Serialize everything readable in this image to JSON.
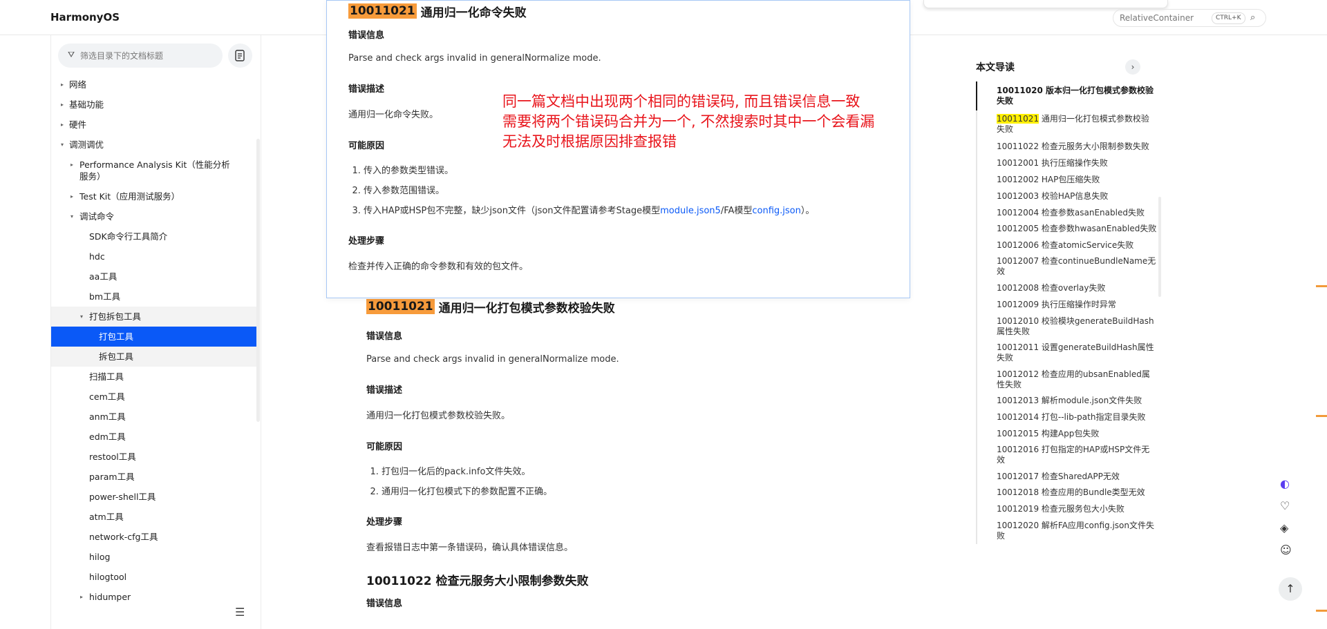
{
  "header": {
    "brand": "HarmonyOS",
    "search_text": "RelativeContainer",
    "search_shortcut": "CTRL+K"
  },
  "sidebar": {
    "filter_placeholder": "筛选目录下的文档标题",
    "items": [
      {
        "label": "网络",
        "arrow": "▸",
        "level": 0
      },
      {
        "label": "基础功能",
        "arrow": "▸",
        "level": 0
      },
      {
        "label": "硬件",
        "arrow": "▸",
        "level": 0
      },
      {
        "label": "调测调优",
        "arrow": "▾",
        "level": 0
      },
      {
        "label": "Performance Analysis Kit（性能分析服务）",
        "arrow": "▸",
        "level": 1
      },
      {
        "label": "Test Kit（应用测试服务）",
        "arrow": "▸",
        "level": 1
      },
      {
        "label": "调试命令",
        "arrow": "▾",
        "level": 1
      },
      {
        "label": "SDK命令行工具简介",
        "arrow": "",
        "level": 2
      },
      {
        "label": "hdc",
        "arrow": "",
        "level": 2
      },
      {
        "label": "aa工具",
        "arrow": "",
        "level": 2
      },
      {
        "label": "bm工具",
        "arrow": "",
        "level": 2
      },
      {
        "label": "打包拆包工具",
        "arrow": "▾",
        "level": 2
      },
      {
        "label": "打包工具",
        "arrow": "",
        "level": 3
      },
      {
        "label": "拆包工具",
        "arrow": "",
        "level": 3
      },
      {
        "label": "扫描工具",
        "arrow": "",
        "level": 2
      },
      {
        "label": "cem工具",
        "arrow": "",
        "level": 2
      },
      {
        "label": "anm工具",
        "arrow": "",
        "level": 2
      },
      {
        "label": "edm工具",
        "arrow": "",
        "level": 2
      },
      {
        "label": "restool工具",
        "arrow": "",
        "level": 2
      },
      {
        "label": "param工具",
        "arrow": "",
        "level": 2
      },
      {
        "label": "power-shell工具",
        "arrow": "",
        "level": 2
      },
      {
        "label": "atm工具",
        "arrow": "",
        "level": 2
      },
      {
        "label": "network-cfg工具",
        "arrow": "",
        "level": 2
      },
      {
        "label": "hilog",
        "arrow": "",
        "level": 2
      },
      {
        "label": "hilogtool",
        "arrow": "",
        "level": 2
      },
      {
        "label": "hidumper",
        "arrow": "▸",
        "level": 2
      }
    ]
  },
  "popup": {
    "code": "10011021",
    "title": "通用归一化命令失败",
    "s1_title": "错误信息",
    "s1_text": "Parse and check args invalid in generalNormalize mode.",
    "s2_title": "错误描述",
    "s2_text": "通用归一化命令失败。",
    "s3_title": "可能原因",
    "causes_1": "传入的参数类型错误。",
    "causes_2": "传入参数范围错误。",
    "cause3_pre": "传入HAP或HSP包不完整，缺少json文件（json文件配置请参考Stage模型",
    "cause3_link1": "module.json5",
    "cause3_mid": "/FA模型",
    "cause3_link2": "config.json",
    "cause3_post": "）。",
    "s4_title": "处理步骤",
    "s4_text": "检查并传入正确的命令参数和有效的包文件。"
  },
  "annotation": {
    "line1": "同一篇文档中出现两个相同的错误码, 而且错误信息一致",
    "line2": "需要将两个错误码合并为一个, 不然搜索时其中一个会看漏",
    "line3": "无法及时根据原因排查报错"
  },
  "main": {
    "code": "10011021",
    "title": "通用归一化打包模式参数校验失败",
    "s1_title": "错误信息",
    "s1_text": "Parse and check args invalid in generalNormalize mode.",
    "s2_title": "错误描述",
    "s2_text": "通用归一化打包模式参数校验失败。",
    "s3_title": "可能原因",
    "causes_1": "打包归一化后的pack.info文件失效。",
    "causes_2": "通用归一化打包模式下的参数配置不正确。",
    "s4_title": "处理步骤",
    "s4_text": "查看报错日志中第一条错误码，确认具体错误信息。",
    "next_title": "10011022 检查元服务大小限制参数失败",
    "next_s1": "错误信息"
  },
  "toc": {
    "title": "本文导读",
    "current": "10011020 版本归一化打包模式参数校验失败",
    "hl_code": "10011021",
    "hl_rest": " 通用归一化打包模式参数校验失败",
    "items": [
      "10011022 检查元服务大小限制参数失败",
      "10012001 执行压缩操作失败",
      "10012002 HAP包压缩失败",
      "10012003 校验HAP信息失败",
      "10012004 检查参数asanEnabled失败",
      "10012005 检查参数hwasanEnabled失败",
      "10012006 检查atomicService失败",
      "10012007 检查continueBundleName无效",
      "10012008 检查overlay失败",
      "10012009 执行压缩操作时异常",
      "10012010 校验模块generateBuildHash属性失败",
      "10012011 设置generateBuildHash属性失败",
      "10012012 检查应用的ubsanEnabled属性失败",
      "10012013 解析module.json文件失败",
      "10012014 打包--lib-path指定目录失败",
      "10012015 构建App包失败",
      "10012016 打包指定的HAP或HSP文件无效",
      "10012017 检查SharedAPP无效",
      "10012018 检查应用的Bundle类型无效",
      "10012019 检查元服务包大小失败",
      "10012020 解析FA应用config.json文件失败"
    ]
  },
  "colors": {
    "accent": "#0a59f7",
    "code_highlight": "#f79b3b",
    "toc_highlight": "#ffef00",
    "annotation": "#e8141b"
  },
  "icons": [
    "filter-icon",
    "doc-list-icon",
    "search-icon",
    "collapse-sidebar-icon",
    "chevron-right-icon",
    "ai-assistant-icon",
    "feedback-icon",
    "layers-icon",
    "smile-icon",
    "arrow-up-icon"
  ]
}
